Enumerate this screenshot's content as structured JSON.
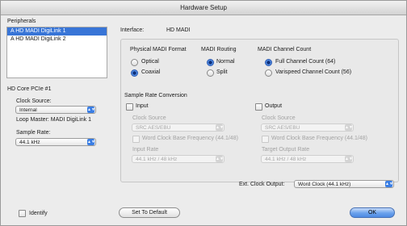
{
  "window": {
    "title": "Hardware Setup"
  },
  "peripherals": {
    "label": "Peripherals",
    "items": [
      "A HD MADI DigiLink 1",
      "A HD MADI DigiLink 2"
    ]
  },
  "device": {
    "name": "HD Core PCIe #1"
  },
  "clock_source": {
    "label": "Clock Source:",
    "value": "Internal"
  },
  "loop_master": {
    "text": "Loop Master: MADI DigiLink 1"
  },
  "sample_rate": {
    "label": "Sample Rate:",
    "value": "44.1 kHz"
  },
  "interface": {
    "label": "Interface:",
    "value": "HD MADI"
  },
  "physical_format": {
    "label": "Physical MADI Format",
    "optical": "Optical",
    "coaxial": "Coaxial"
  },
  "routing": {
    "label": "MADI Routing",
    "normal": "Normal",
    "split": "Split"
  },
  "channel_count": {
    "label": "MADI Channel Count",
    "full": "Full Channel Count (64)",
    "varispeed": "Varispeed Channel Count (56)"
  },
  "src": {
    "label": "Sample Rate Conversion",
    "input": {
      "label": "Input",
      "clock_source_label": "Clock Source",
      "clock_source_value": "SRC AES/EBU",
      "word_clock": "Word Clock Base Frequency (44.1/48)",
      "rate_label": "Input Rate",
      "rate_value": "44.1 kHz / 48 kHz"
    },
    "output": {
      "label": "Output",
      "clock_source_label": "Clock Source",
      "clock_source_value": "SRC AES/EBU",
      "word_clock": "Word Clock Base Frequency (44.1/48)",
      "rate_label": "Target Output Rate",
      "rate_value": "44.1 kHz / 48 kHz"
    }
  },
  "ext_clock": {
    "label": "Ext. Clock Output:",
    "value": "Word Clock (44.1 kHz)"
  },
  "footer": {
    "identify": "Identify",
    "default": "Set To Default",
    "ok": "OK"
  },
  "icons": {
    "select_arrow": "updown-arrow-icon"
  },
  "colors": {
    "accent": "#3875d7",
    "button_primary": "#6aa1ec"
  }
}
